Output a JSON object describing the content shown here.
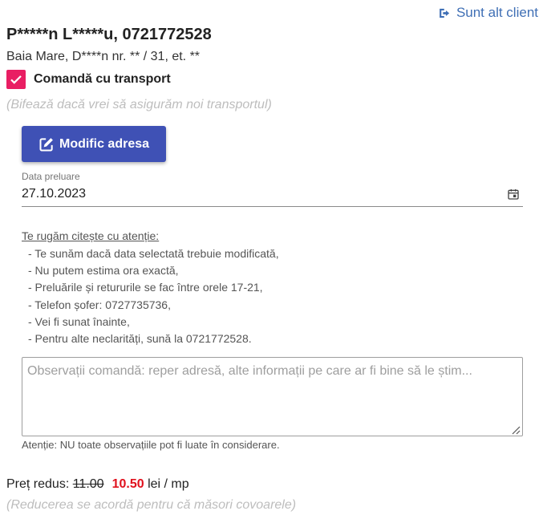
{
  "header": {
    "switch_client_label": "Sunt alt client"
  },
  "client": {
    "name_phone": "P*****n L*****u, 0721772528",
    "address": "Baia Mare, D****n nr. ** / 31, et. **"
  },
  "transport": {
    "label": "Comandă cu transport",
    "checked": true,
    "hint": "(Bifează dacă vrei să asigurăm noi transportul)"
  },
  "edit_address": {
    "label": "Modific adresa"
  },
  "pickup_date": {
    "label": "Data preluare",
    "value": "27.10.2023"
  },
  "notice": {
    "title": "Te rugăm citește cu atenție:",
    "items": [
      "- Te sunăm dacă data selectată trebuie modificată,",
      "- Nu putem estima ora exactă,",
      "- Preluările și retururile se fac între orele 17-21,",
      "- Telefon șofer: 0727735736,",
      "- Vei fi sunat înainte,",
      "- Pentru alte neclarități, sună la 0721772528."
    ]
  },
  "observations": {
    "value": "",
    "placeholder": "Observații comandă: reper adresă, alte informații pe care ar fi bine să le știm...",
    "note": "Atenție: NU toate observațiile pot fi luate în considerare."
  },
  "price": {
    "label": "Preț redus:",
    "old": "11.00",
    "new": "10.50",
    "unit": "lei / mp",
    "hint": "(Reducerea se acordă pentru că măsori covoarele)"
  },
  "colors": {
    "accent_link": "#3f6fb5",
    "checkbox": "#e91e63",
    "primary_button": "#3f51b5",
    "price_highlight": "#e0111d"
  },
  "icons": {
    "switch_client": "sign-out-icon",
    "checkbox": "checkmark-icon",
    "edit": "edit-square-icon",
    "calendar": "calendar-icon",
    "resize": "resize-grip-icon"
  }
}
